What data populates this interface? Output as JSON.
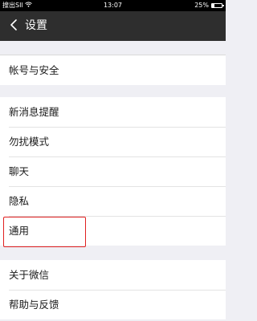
{
  "status_bar": {
    "carrier": "搜出SIl",
    "time": "13:07",
    "battery_text": "25%",
    "battery_level": 0.25
  },
  "header": {
    "title": "设置",
    "back_icon": "chevron-left-icon"
  },
  "groups": [
    {
      "items": [
        {
          "label": "帐号与安全"
        }
      ]
    },
    {
      "items": [
        {
          "label": "新消息提醒"
        },
        {
          "label": "勿扰模式"
        },
        {
          "label": "聊天"
        },
        {
          "label": "隐私"
        },
        {
          "label": "通用",
          "highlighted": true
        }
      ]
    },
    {
      "items": [
        {
          "label": "关于微信"
        },
        {
          "label": "帮助与反馈"
        }
      ]
    }
  ],
  "colors": {
    "header_bg": "#2e2e2e",
    "page_bg": "#efeff4",
    "highlight": "#e02020"
  }
}
